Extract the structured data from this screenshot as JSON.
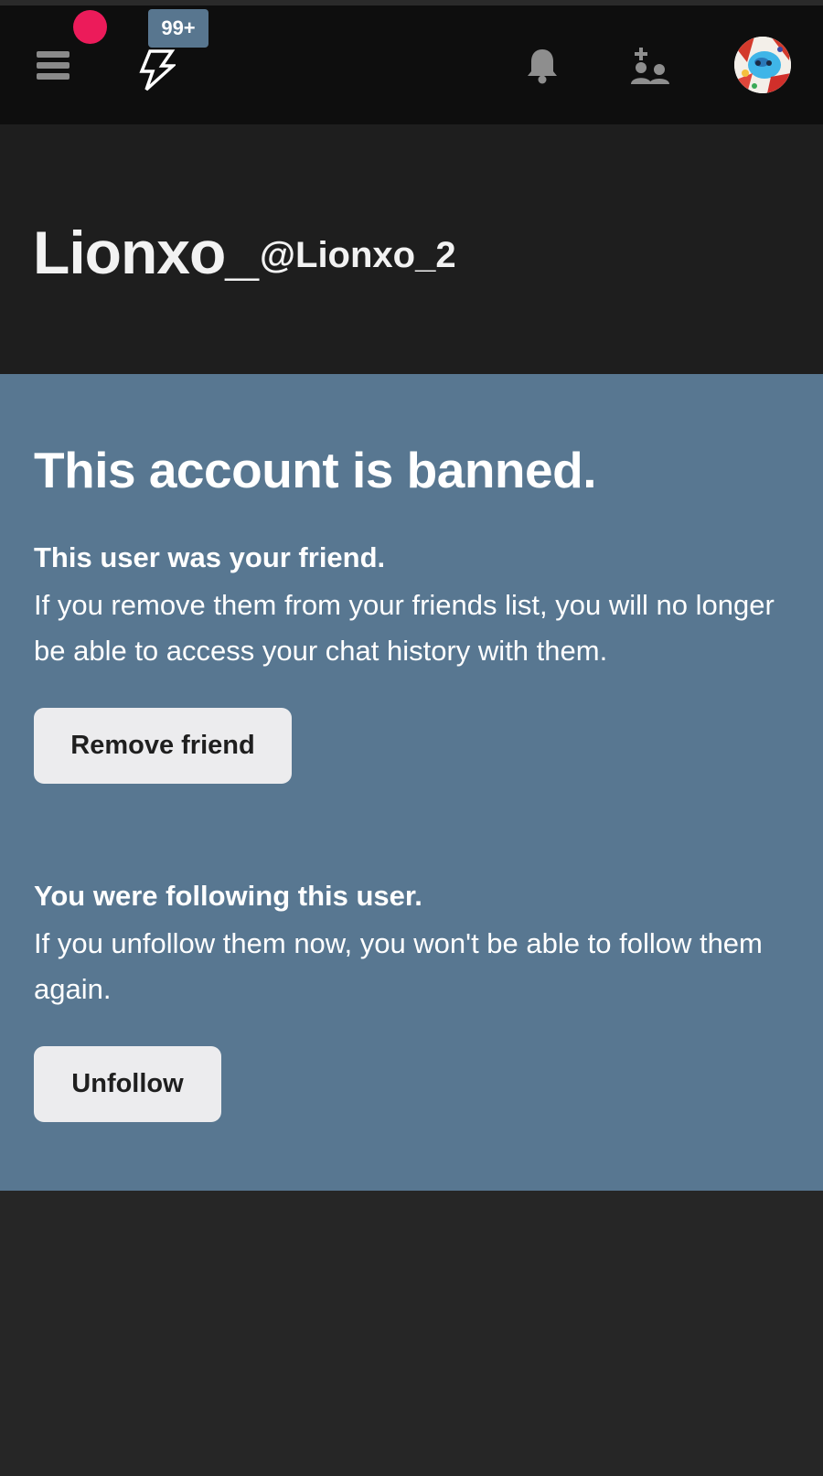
{
  "topbar": {
    "menu_icon": "hamburger-menu-icon",
    "logo_icon": "lightning-bolt-logo-icon",
    "notification_count": "99+",
    "bell_icon": "bell-icon",
    "friend_icon": "friend-requests-icon",
    "avatar": "user-avatar",
    "dot_color": "#ec1b5a",
    "badge_color": "#58768f"
  },
  "profile": {
    "display_name": "Lionxo_",
    "handle": "@Lionxo_2"
  },
  "banned": {
    "title": "This account is banned.",
    "friend_heading": "This user was your friend.",
    "friend_text": "If you remove them from your friends list, you will no longer be able to access your chat history with them.",
    "remove_friend_label": "Remove friend",
    "following_heading": "You were following this user.",
    "following_text": "If you unfollow them now, you won't be able to follow them again.",
    "unfollow_label": "Unfollow",
    "panel_color": "#587791"
  }
}
